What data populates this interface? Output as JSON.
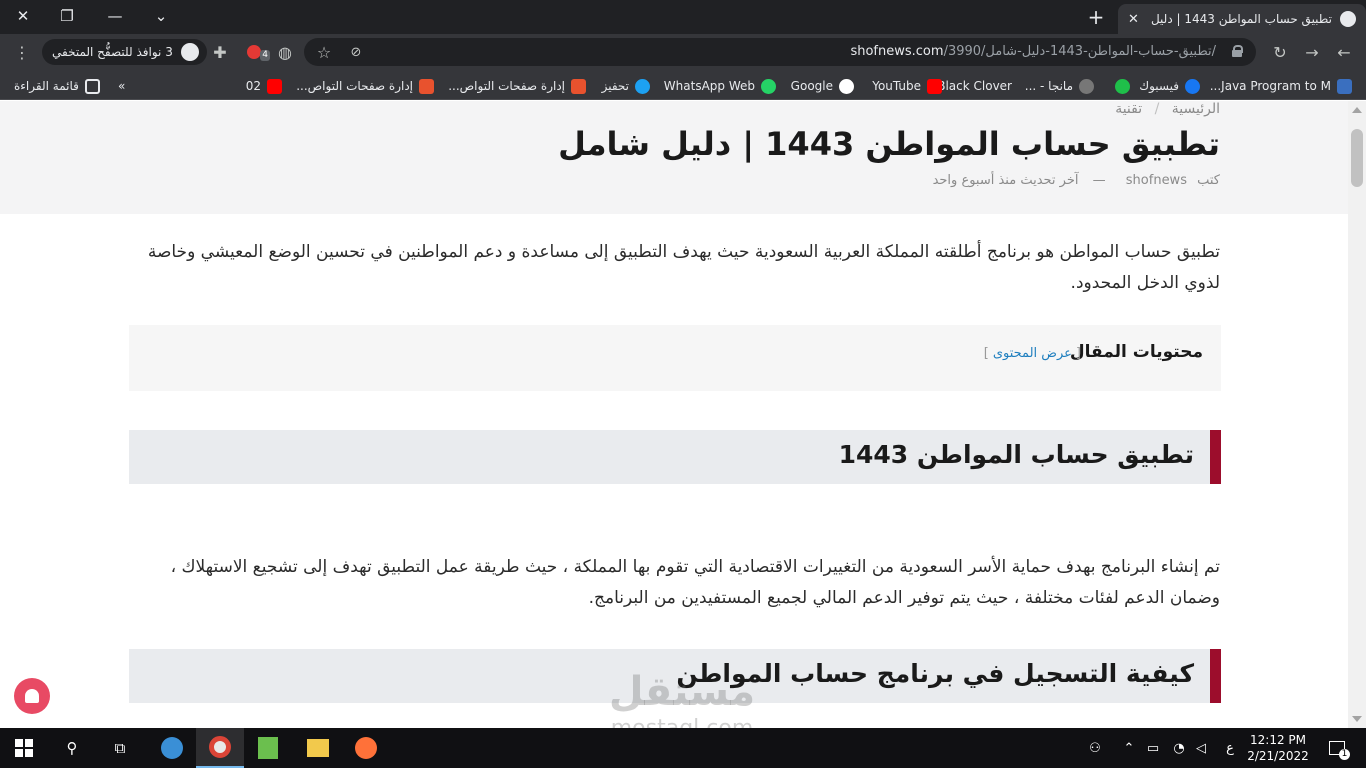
{
  "browser": {
    "tab_title": "تطبيق حساب المواطن 1443 | دليل",
    "new_tab_glyph": "+",
    "url_host": "shofnews.com",
    "url_path": "/3990/تطبيق-حساب-المواطن-1443-دليل-شامل/",
    "incognito_label": "3 نوافذ للتصفُّح المتخفي",
    "extension_badge": "4"
  },
  "bookmarks": [
    {
      "label": "Java Program to M...",
      "color": "#3a6fbf"
    },
    {
      "label": "فيسبوك",
      "color": "#1877f2"
    },
    {
      "label": "",
      "color": "#1fbf4a"
    },
    {
      "label": "مانجا - ...",
      "color": "#777777"
    },
    {
      "label": "Black Clover",
      "color": "#444444"
    },
    {
      "label": "YouTube",
      "color": "#ff0000"
    },
    {
      "label": "Google",
      "color": "#ffffff"
    },
    {
      "label": "WhatsApp Web",
      "color": "#25d366"
    },
    {
      "label": "تحفيز",
      "color": "#1da1f2"
    },
    {
      "label": "إدارة صفحات التواص...",
      "color": "#e8522e"
    },
    {
      "label": "إدارة صفحات التواص...",
      "color": "#e8522e"
    },
    {
      "label": "02",
      "color": "#ff0000"
    }
  ],
  "bookmarks_overflow": "»",
  "reading_list": "قائمة القراءة",
  "article": {
    "breadcrumb_home": "الرئيسية",
    "breadcrumb_sep": "/",
    "breadcrumb_cat": "تقنية",
    "title": "تطبيق حساب المواطن 1443 | دليل شامل",
    "author_prefix": "كتب",
    "author": "shofnews",
    "dash": "—",
    "updated": "آخر تحديث منذ أسبوع واحد",
    "intro": "تطبيق حساب المواطن هو برنامج أطلقته المملكة العربية السعودية حيث يهدف التطبيق إلى مساعدة و دعم المواطنين في تحسين الوضع المعيشي وخاصة لذوي الدخل المحدود.",
    "toc_title": "محتويات المقال",
    "toc_toggle": "عرض المحتوى",
    "toc_open": "[",
    "toc_close": "]",
    "h2_1": "تطبيق حساب المواطن 1443",
    "para_2": "تم إنشاء البرنامج بهدف حماية الأسر السعودية من التغييرات الاقتصادية التي تقوم بها المملكة ، حيث طريقة عمل التطبيق تهدف إلى تشجيع الاستهلاك ، وضمان الدعم لفئات مختلفة ، حيث يتم توفير الدعم المالي لجميع المستفيدين من البرنامج.",
    "h2_2": "كيفية التسجيل في برنامج حساب المواطن"
  },
  "watermark": {
    "line1": "مستقل",
    "line2": "mostaql.com"
  },
  "taskbar": {
    "time": "12:12 PM",
    "date": "2/21/2022",
    "lang": "ع",
    "notifications": "1"
  }
}
